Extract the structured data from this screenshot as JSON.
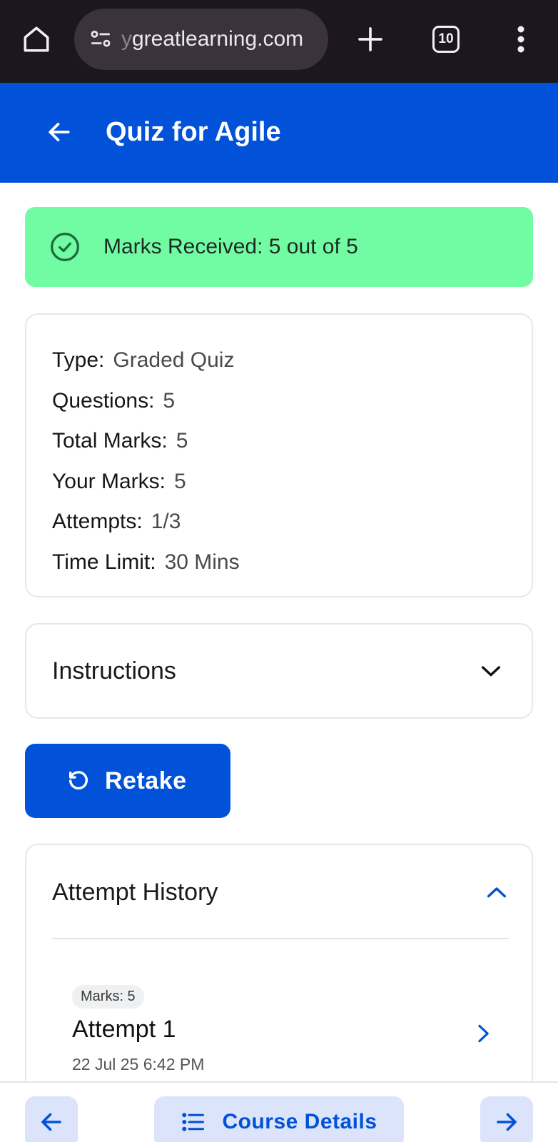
{
  "browser": {
    "url_prefix": "y",
    "url": "greatlearning.com",
    "tab_count": "10",
    "icons": [
      "home-icon",
      "site-settings-icon",
      "plus-icon",
      "tabs-icon",
      "more-vert-icon"
    ]
  },
  "header": {
    "title": "Quiz for Agile",
    "back_icon": "arrow-left-icon",
    "background": "#0152d8"
  },
  "score_banner": {
    "text": "Marks Received: 5 out of 5",
    "icon": "check-circle-icon",
    "background": "#71fca3"
  },
  "info": {
    "rows": [
      {
        "label": "Type:",
        "value": "Graded Quiz"
      },
      {
        "label": "Questions:",
        "value": "5"
      },
      {
        "label": "Total Marks:",
        "value": "5"
      },
      {
        "label": "Your Marks:",
        "value": "5"
      },
      {
        "label": "Attempts:",
        "value": "1/3"
      },
      {
        "label": "Time Limit:",
        "value": "30 Mins"
      }
    ]
  },
  "instructions": {
    "title": "Instructions",
    "icon": "chevron-down-icon"
  },
  "retake": {
    "label": "Retake",
    "icon": "retake-icon"
  },
  "attempt_history": {
    "title": "Attempt History",
    "icon": "chevron-up-icon",
    "attempts": [
      {
        "badge": "Marks: 5",
        "title": "Attempt 1",
        "date": "22 Jul 25 6:42 PM"
      }
    ]
  },
  "bottom_nav": {
    "prev_icon": "arrow-left-icon",
    "course_label": "Course Details",
    "course_icon": "list-icon",
    "next_icon": "arrow-right-icon"
  },
  "colors": {
    "accent": "#0152d8",
    "success": "#71fca3",
    "nav_button_bg": "#dce4fb"
  }
}
